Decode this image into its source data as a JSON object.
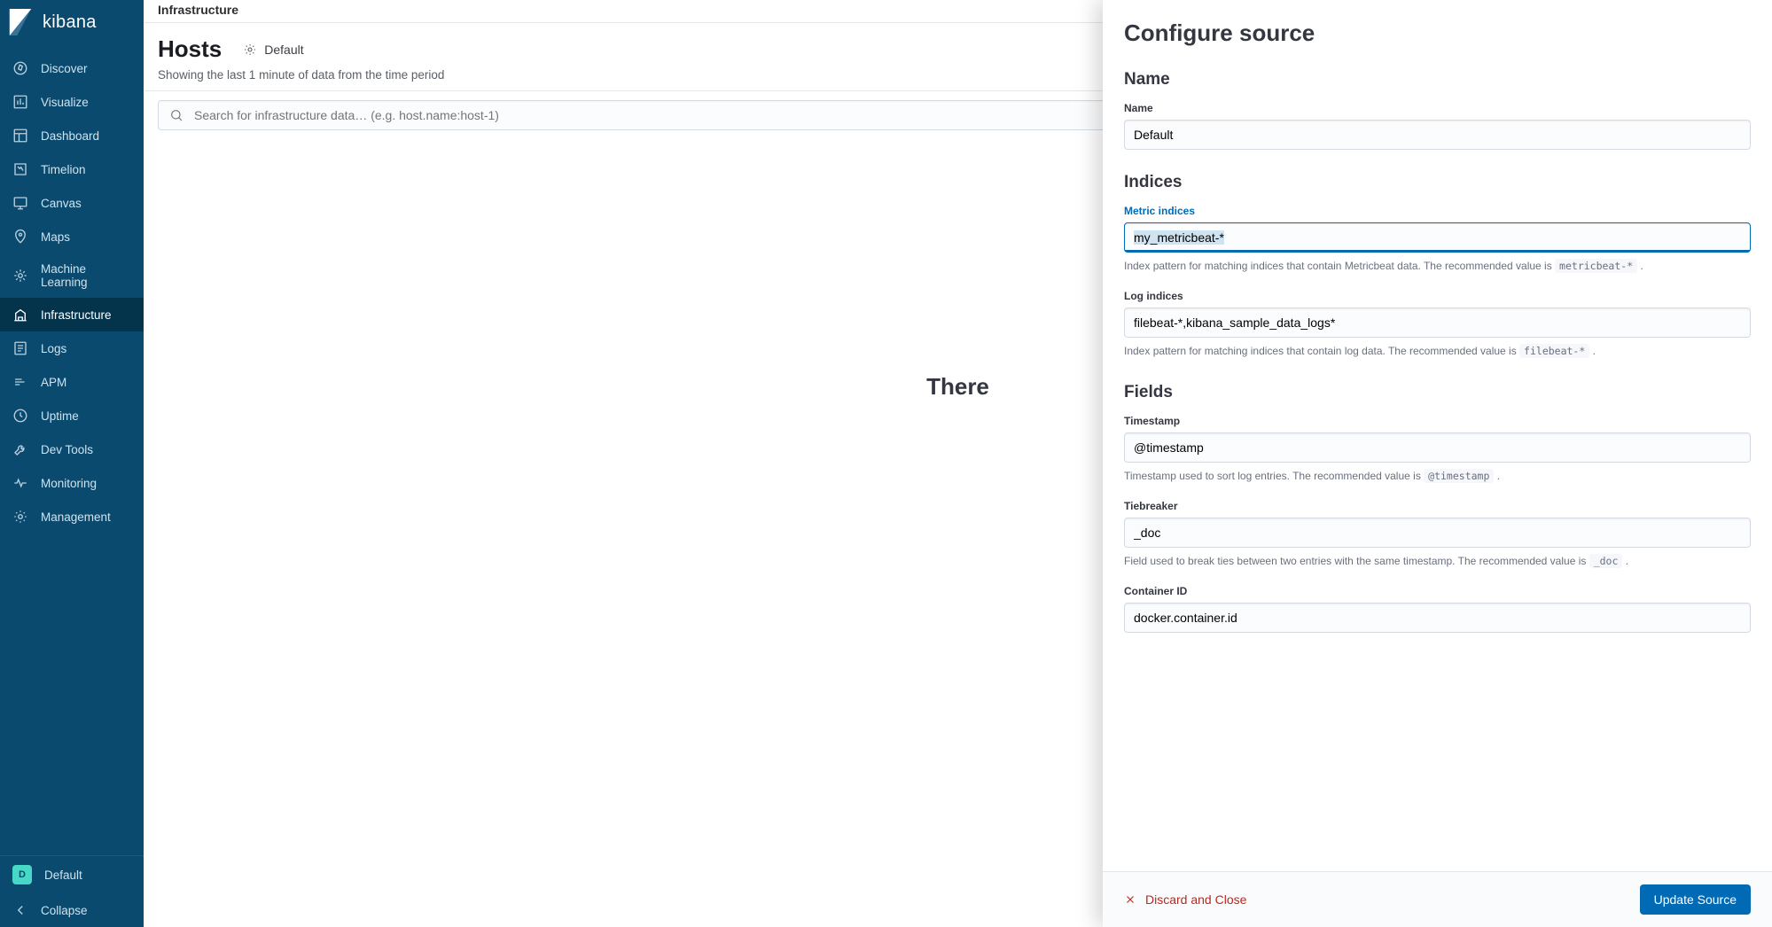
{
  "brand": "kibana",
  "sidebar": {
    "items": [
      {
        "label": "Discover"
      },
      {
        "label": "Visualize"
      },
      {
        "label": "Dashboard"
      },
      {
        "label": "Timelion"
      },
      {
        "label": "Canvas"
      },
      {
        "label": "Maps"
      },
      {
        "label": "Machine Learning"
      },
      {
        "label": "Infrastructure"
      },
      {
        "label": "Logs"
      },
      {
        "label": "APM"
      },
      {
        "label": "Uptime"
      },
      {
        "label": "Dev Tools"
      },
      {
        "label": "Monitoring"
      },
      {
        "label": "Management"
      }
    ],
    "user": {
      "initial": "D",
      "name": "Default"
    },
    "collapse": "Collapse"
  },
  "main": {
    "breadcrumb": "Infrastructure",
    "title": "Hosts",
    "source_button": "Default",
    "subtitle": "Showing the last 1 minute of data from the time period",
    "search_placeholder": "Search for infrastructure data… (e.g. host.name:host-1)",
    "empty_title": "There"
  },
  "flyout": {
    "title": "Configure source",
    "sections": {
      "name": {
        "heading": "Name",
        "label": "Name",
        "value": "Default"
      },
      "indices": {
        "heading": "Indices",
        "metric": {
          "label": "Metric indices",
          "value": "my_metricbeat-*",
          "help_pre": "Index pattern for matching indices that contain Metricbeat data. The recommended value is ",
          "help_code": "metricbeat-*",
          "help_post": " ."
        },
        "log": {
          "label": "Log indices",
          "value": "filebeat-*,kibana_sample_data_logs*",
          "help_pre": "Index pattern for matching indices that contain log data. The recommended value is ",
          "help_code": "filebeat-*",
          "help_post": " ."
        }
      },
      "fields": {
        "heading": "Fields",
        "timestamp": {
          "label": "Timestamp",
          "value": "@timestamp",
          "help_pre": "Timestamp used to sort log entries. The recommended value is ",
          "help_code": "@timestamp",
          "help_post": " ."
        },
        "tiebreaker": {
          "label": "Tiebreaker",
          "value": "_doc",
          "help_pre": "Field used to break ties between two entries with the same timestamp. The recommended value is ",
          "help_code": "_doc",
          "help_post": " ."
        },
        "container": {
          "label": "Container ID",
          "value": "docker.container.id"
        }
      }
    },
    "footer": {
      "discard": "Discard and Close",
      "update": "Update Source"
    }
  }
}
